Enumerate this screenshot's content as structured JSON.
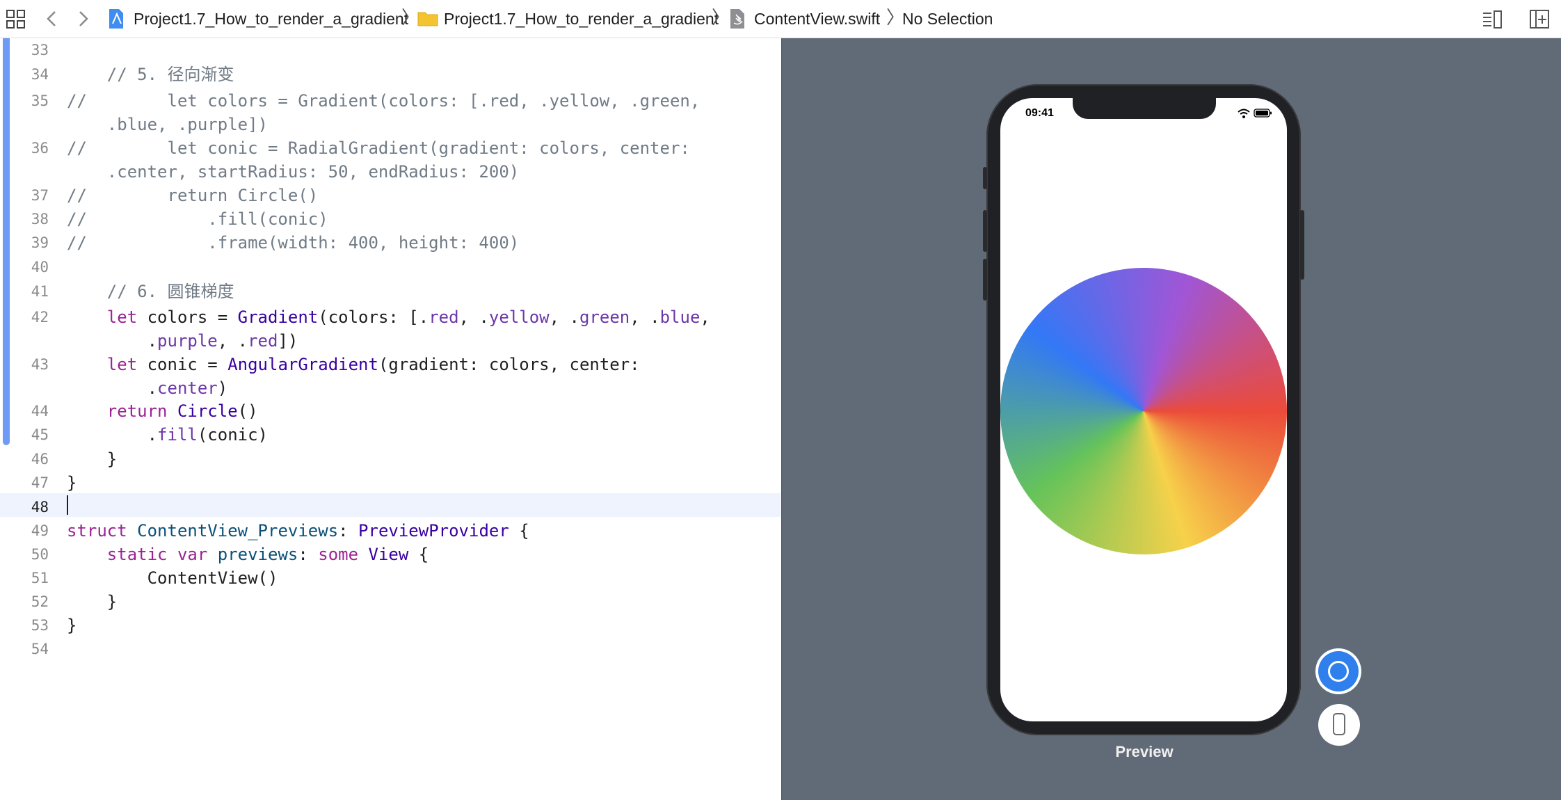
{
  "toolbar": {
    "grid_icon": "related-items-grid-icon",
    "back_icon": "chevron-left-icon",
    "forward_icon": "chevron-right-icon",
    "breadcrumb": [
      {
        "label": "Project1.7_How_to_render_a_gradient",
        "icon": "xcode-project-icon"
      },
      {
        "label": "Project1.7_How_to_render_a_gradient",
        "icon": "folder-icon"
      },
      {
        "label": "ContentView.swift",
        "icon": "swift-file-icon"
      },
      {
        "label": "No Selection",
        "icon": ""
      }
    ],
    "right_icons": [
      "editor-options-icon",
      "add-editor-icon"
    ]
  },
  "editor": {
    "current_line": "48",
    "line_numbers": [
      "33",
      "34",
      "35",
      "36",
      "37",
      "38",
      "39",
      "40",
      "41",
      "42",
      "43",
      "44",
      "45",
      "46",
      "47",
      "48",
      "49",
      "50",
      "51",
      "52",
      "53",
      "54"
    ]
  },
  "canvas": {
    "status_time": "09:41",
    "preview_label": "Preview",
    "live_button_icon": "live-preview-icon",
    "device_button_icon": "device-preview-icon",
    "gradient_colors": [
      "#eb4b3a",
      "#f7d14a",
      "#65c35a",
      "#3378f6",
      "#a056d6"
    ],
    "canvas_bg": "#616b77"
  }
}
